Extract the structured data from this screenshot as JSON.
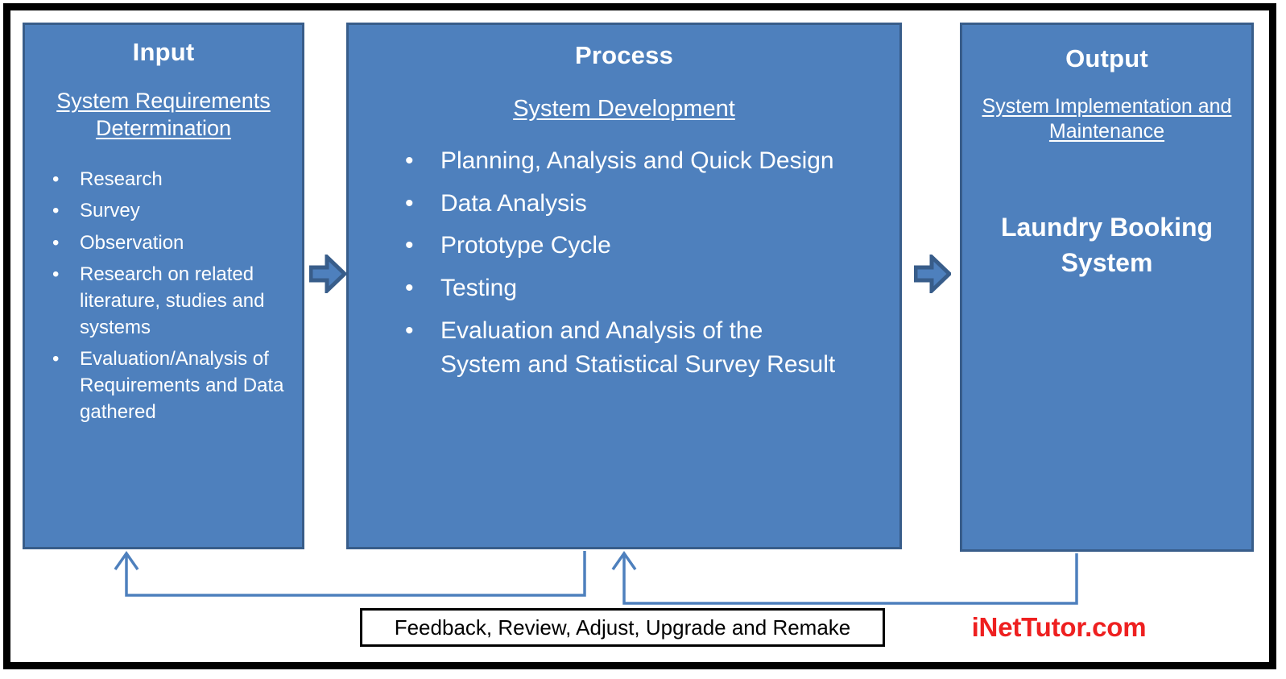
{
  "diagram": {
    "type": "IPO (Input-Process-Output) conceptual framework",
    "accent_box_fill": "#4E80BD",
    "accent_box_border": "#385D8A",
    "connector_color": "#4E80BD",
    "frame_color": "#000000",
    "brand_color": "#EE2020"
  },
  "input": {
    "title": "Input",
    "subtitle": "System Requirements Determination",
    "bullets": [
      "Research",
      "Survey",
      "Observation",
      "Research on related literature, studies and systems",
      "Evaluation/Analysis of Requirements and Data gathered"
    ]
  },
  "process": {
    "title": "Process",
    "subtitle": "System Development",
    "bullets": [
      "Planning, Analysis and Quick Design",
      "Data Analysis",
      "Prototype Cycle",
      "Testing",
      "Evaluation and Analysis of the System and Statistical Survey Result"
    ]
  },
  "output": {
    "title": "Output",
    "subtitle": "System Implementation and Maintenance",
    "headline": "Laundry Booking System"
  },
  "feedback": {
    "label": "Feedback, Review, Adjust, Upgrade and Remake"
  },
  "brand": {
    "text": "iNetTutor.com"
  },
  "icons": {
    "arrow_input_process": "right-block-arrow-icon",
    "arrow_process_output": "right-block-arrow-icon",
    "feedback_loop_left": "feedback-loop-arrow-icon",
    "feedback_loop_right": "feedback-loop-arrow-icon"
  }
}
